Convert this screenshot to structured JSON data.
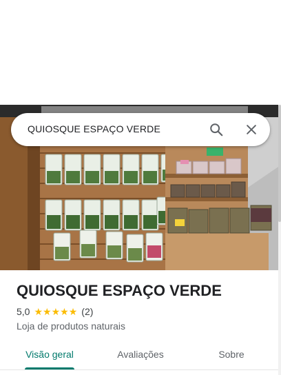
{
  "search": {
    "query": "QUIOSQUE ESPAÇO VERDE"
  },
  "icons": {
    "search": "search-icon",
    "close": "close-icon",
    "star": "star-icon"
  },
  "place": {
    "name": "QUIOSQUE ESPAÇO VERDE",
    "rating": "5,0",
    "rating_value": 5.0,
    "stars_filled": 5,
    "review_count": "(2)",
    "category": "Loja de produtos naturais"
  },
  "tabs": [
    {
      "label": "Visão geral",
      "active": true
    },
    {
      "label": "Avaliações",
      "active": false
    },
    {
      "label": "Sobre",
      "active": false
    }
  ],
  "colors": {
    "accent": "#00796b",
    "star": "#fbbc04",
    "text_primary": "#202124",
    "text_secondary": "#5f6368"
  }
}
